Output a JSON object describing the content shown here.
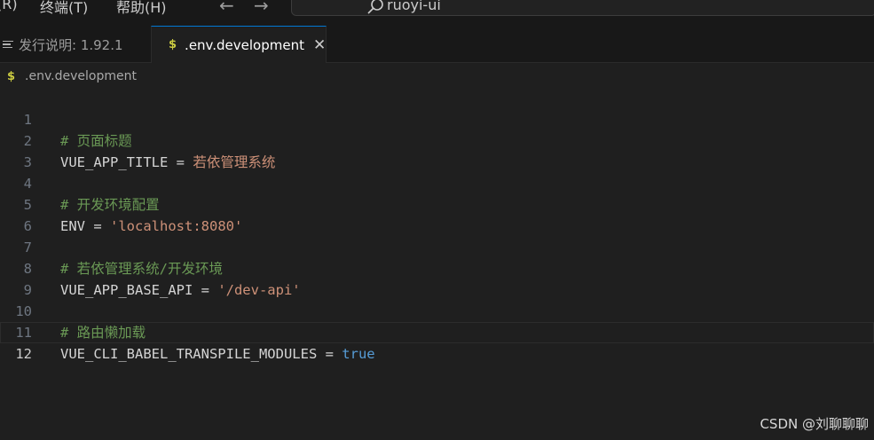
{
  "titlebar": {
    "menu": [
      "(R)",
      "终端(T)",
      "帮助(H)"
    ],
    "nav_back_icon": "arrow-left-icon",
    "nav_forward_icon": "arrow-right-icon",
    "command_center_label": "ruoyi-ui"
  },
  "tabs": [
    {
      "label": "发行说明: 1.92.1",
      "icon": "list-icon",
      "active": false
    },
    {
      "label": ".env.development",
      "icon": "dollar-icon",
      "active": true,
      "close_icon": "close-icon"
    }
  ],
  "icon_glyphs": {
    "dollar": "$",
    "close": "✕",
    "back": "←",
    "forward": "→"
  },
  "breadcrumb": {
    "label": ".env.development",
    "icon": "dollar-icon"
  },
  "editor": {
    "current_line": 12,
    "lines": [
      {
        "n": "1",
        "comment": "# 页面标题"
      },
      {
        "n": "2",
        "key": "VUE_APP_TITLE",
        "op": " = ",
        "value": "若依管理系统",
        "value_type": "plain"
      },
      {
        "n": "3"
      },
      {
        "n": "4",
        "comment": "# 开发环境配置"
      },
      {
        "n": "5",
        "key": "ENV",
        "op": " = ",
        "value": "'localhost:8080'",
        "value_type": "string"
      },
      {
        "n": "6"
      },
      {
        "n": "7",
        "comment": "# 若依管理系统/开发环境"
      },
      {
        "n": "8",
        "key": "VUE_APP_BASE_API",
        "op": " = ",
        "value": "'/dev-api'",
        "value_type": "string"
      },
      {
        "n": "9"
      },
      {
        "n": "10",
        "comment": "# 路由懒加载"
      },
      {
        "n": "11",
        "key": "VUE_CLI_BABEL_TRANSPILE_MODULES",
        "op": " = ",
        "value": "true",
        "value_type": "boolean"
      },
      {
        "n": "12"
      }
    ]
  },
  "watermark": "CSDN @刘聊聊聊",
  "colors": {
    "background": "#1f1f1f",
    "comment": "#6a9955",
    "string": "#ce9178",
    "boolean": "#569cd6",
    "dollar_icon": "#cbcb41",
    "active_tab_border": "#0078d4"
  }
}
